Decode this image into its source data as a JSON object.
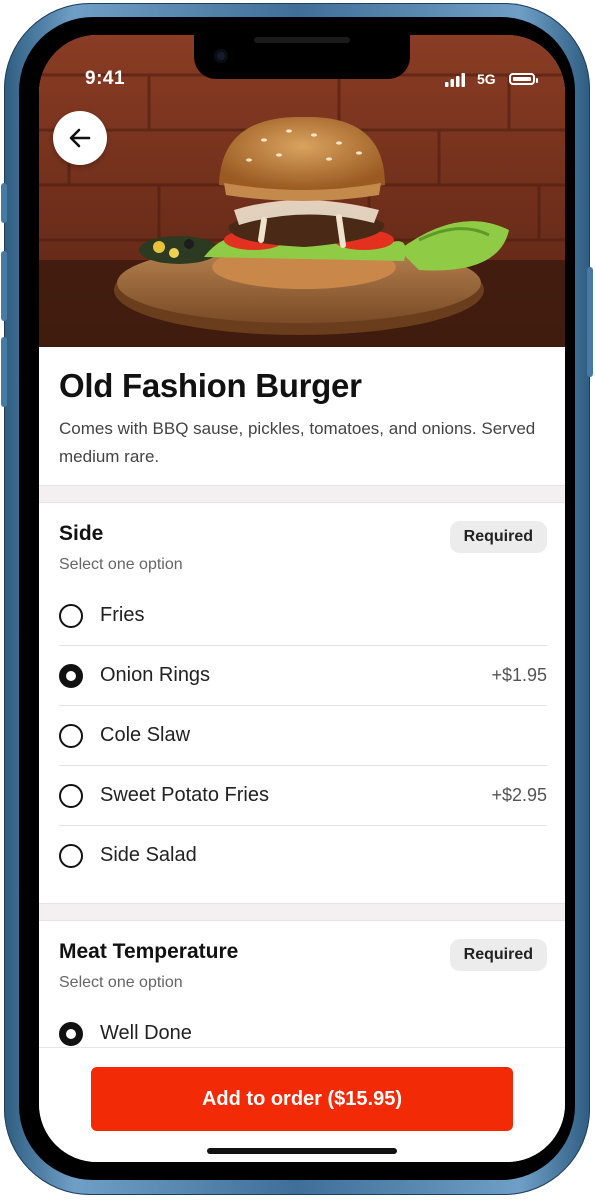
{
  "status_bar": {
    "time": "9:41",
    "network": "5G"
  },
  "product": {
    "title": "Old Fashion Burger",
    "description": "Comes with BBQ sause, pickles, tomatoes, and onions. Served medium rare."
  },
  "sections": [
    {
      "title": "Side",
      "subtitle": "Select one option",
      "badge": "Required",
      "options": [
        {
          "label": "Fries",
          "price": "",
          "selected": false
        },
        {
          "label": "Onion Rings",
          "price": "+$1.95",
          "selected": true
        },
        {
          "label": "Cole Slaw",
          "price": "",
          "selected": false
        },
        {
          "label": "Sweet Potato Fries",
          "price": "+$2.95",
          "selected": false
        },
        {
          "label": "Side Salad",
          "price": "",
          "selected": false
        }
      ]
    },
    {
      "title": "Meat Temperature",
      "subtitle": "Select one option",
      "badge": "Required",
      "options": [
        {
          "label": "Well Done",
          "price": "",
          "selected": true
        }
      ]
    }
  ],
  "footer": {
    "cta_label": "Add to order ($15.95)"
  },
  "colors": {
    "accent": "#f22a06",
    "badge_bg": "#ececec",
    "frame": "#4f80aa"
  },
  "icons": {
    "back": "arrow-left-icon"
  }
}
